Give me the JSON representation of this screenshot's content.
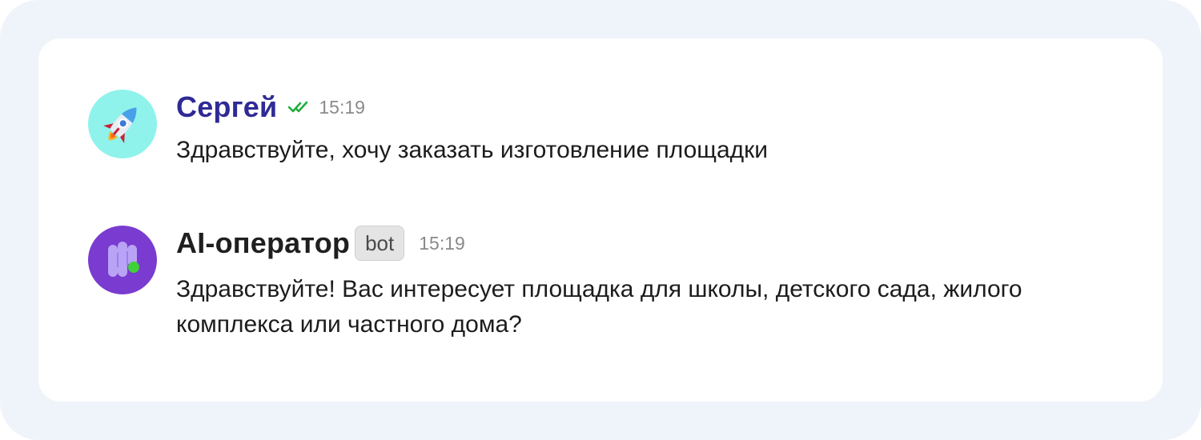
{
  "colors": {
    "outer_background": "#eff4fb",
    "card_background": "#ffffff",
    "user_name": "#2f2a96",
    "bot_name": "#1f1f1f",
    "read_check": "#1fae3c",
    "timestamp": "#8a8a8a",
    "user_avatar_bg": "#8ff3ec",
    "bot_avatar_bg": "#7a3bd0"
  },
  "messages": [
    {
      "author": "Сергей",
      "avatar_icon": "rocket-icon",
      "status_icon": "double-check-icon",
      "time": "15:19",
      "text": "Здравствуйте, хочу заказать изготовление площадки"
    },
    {
      "author": "AI-оператор",
      "avatar_icon": "ai-operator-logo-icon",
      "badge": "bot",
      "time": "15:19",
      "text": "Здравствуйте! Вас интересует площадка для школы, детского сада, жилого комплекса или частного дома?"
    }
  ]
}
